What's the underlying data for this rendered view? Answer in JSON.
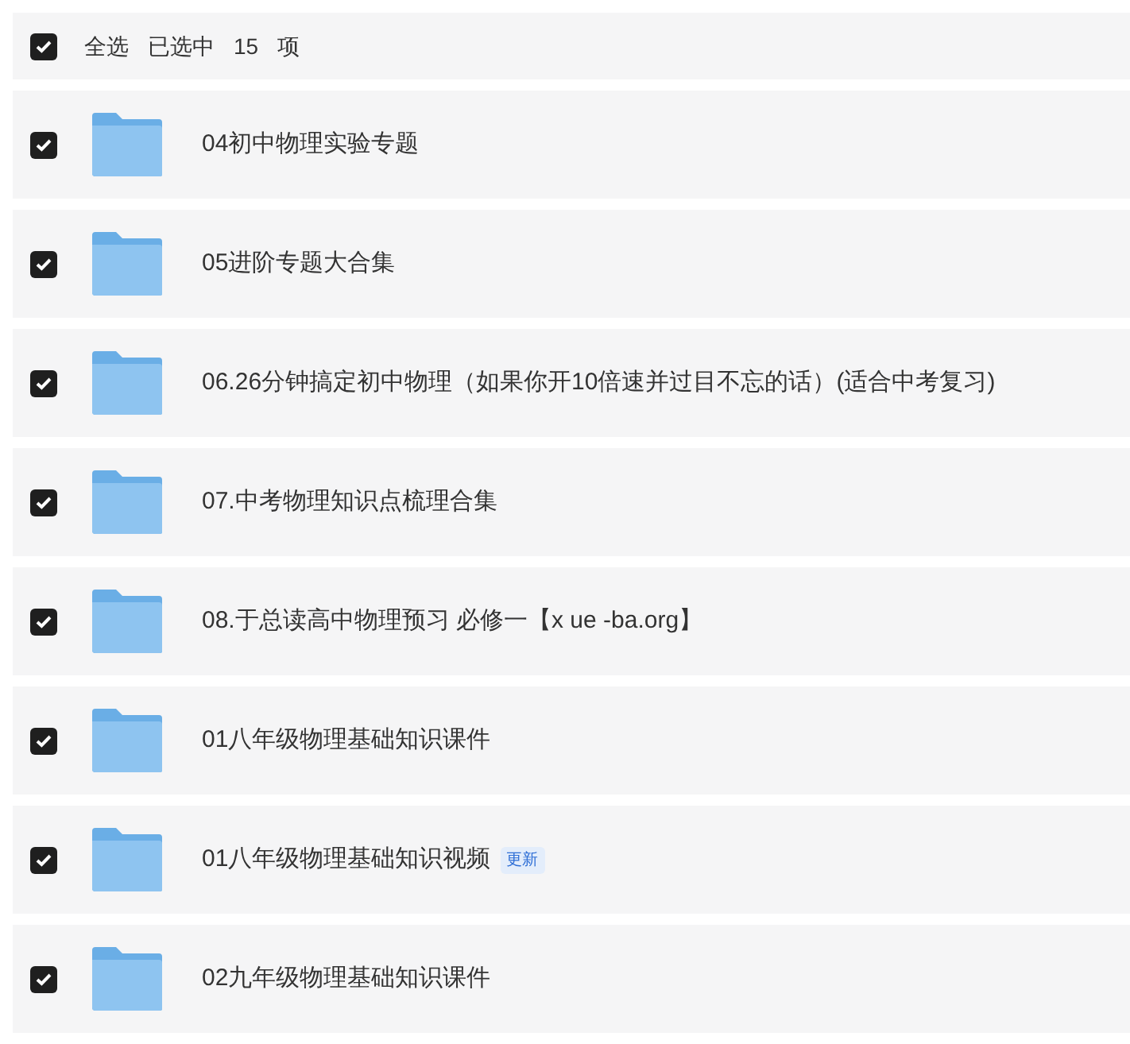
{
  "header": {
    "checked": true,
    "select_all_label": "全选",
    "selected_label": "已选中",
    "count": "15",
    "unit": "项"
  },
  "folders": [
    {
      "name": "04初中物理实验专题",
      "checked": true
    },
    {
      "name": "05进阶专题大合集",
      "checked": true
    },
    {
      "name": "06.26分钟搞定初中物理（如果你开10倍速并过目不忘的话）(适合中考复习)",
      "checked": true
    },
    {
      "name": "07.中考物理知识点梳理合集",
      "checked": true
    },
    {
      "name": "08.于总读高中物理预习 必修一【x ue -ba.org】",
      "checked": true
    },
    {
      "name": "01八年级物理基础知识课件",
      "checked": true
    },
    {
      "name": "01八年级物理基础知识视频",
      "checked": true,
      "badge": "更新"
    },
    {
      "name": "02九年级物理基础知识课件",
      "checked": true
    }
  ]
}
